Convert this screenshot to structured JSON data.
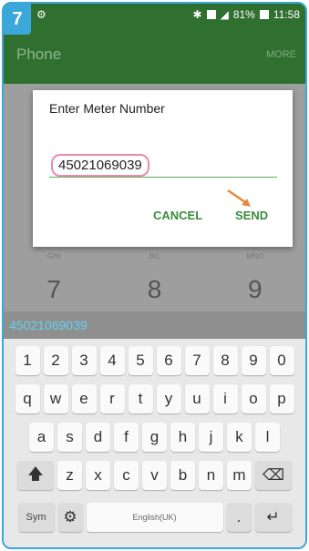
{
  "step_badge": "7",
  "status_bar": {
    "battery": "81%",
    "time": "11:58"
  },
  "app_bar": {
    "title": "Phone",
    "more": "MORE"
  },
  "dialer": {
    "row_subs": [
      "GHI",
      "JKL",
      "MNO"
    ],
    "row_digits": [
      "7",
      "8",
      "9"
    ]
  },
  "dialog": {
    "title": "Enter Meter Number",
    "input_value": "45021069039",
    "cancel_label": "CANCEL",
    "send_label": "SEND"
  },
  "number_strip": "45021069039",
  "keyboard": {
    "row1": [
      "1",
      "2",
      "3",
      "4",
      "5",
      "6",
      "7",
      "8",
      "9",
      "0"
    ],
    "row2": [
      "q",
      "w",
      "e",
      "r",
      "t",
      "y",
      "u",
      "i",
      "o",
      "p"
    ],
    "row3": [
      "a",
      "s",
      "d",
      "f",
      "g",
      "h",
      "j",
      "k",
      "l"
    ],
    "row4": [
      "z",
      "x",
      "c",
      "v",
      "b",
      "n",
      "m"
    ],
    "sym_label": "Sym",
    "space_label": "English(UK)",
    "dot_label": "."
  },
  "colors": {
    "accent": "#3aa8d8",
    "appbar": "#2f6f2f",
    "dialog_button": "#3b8c3b",
    "highlight": "#e98bb0",
    "arrow": "#e8893a"
  }
}
